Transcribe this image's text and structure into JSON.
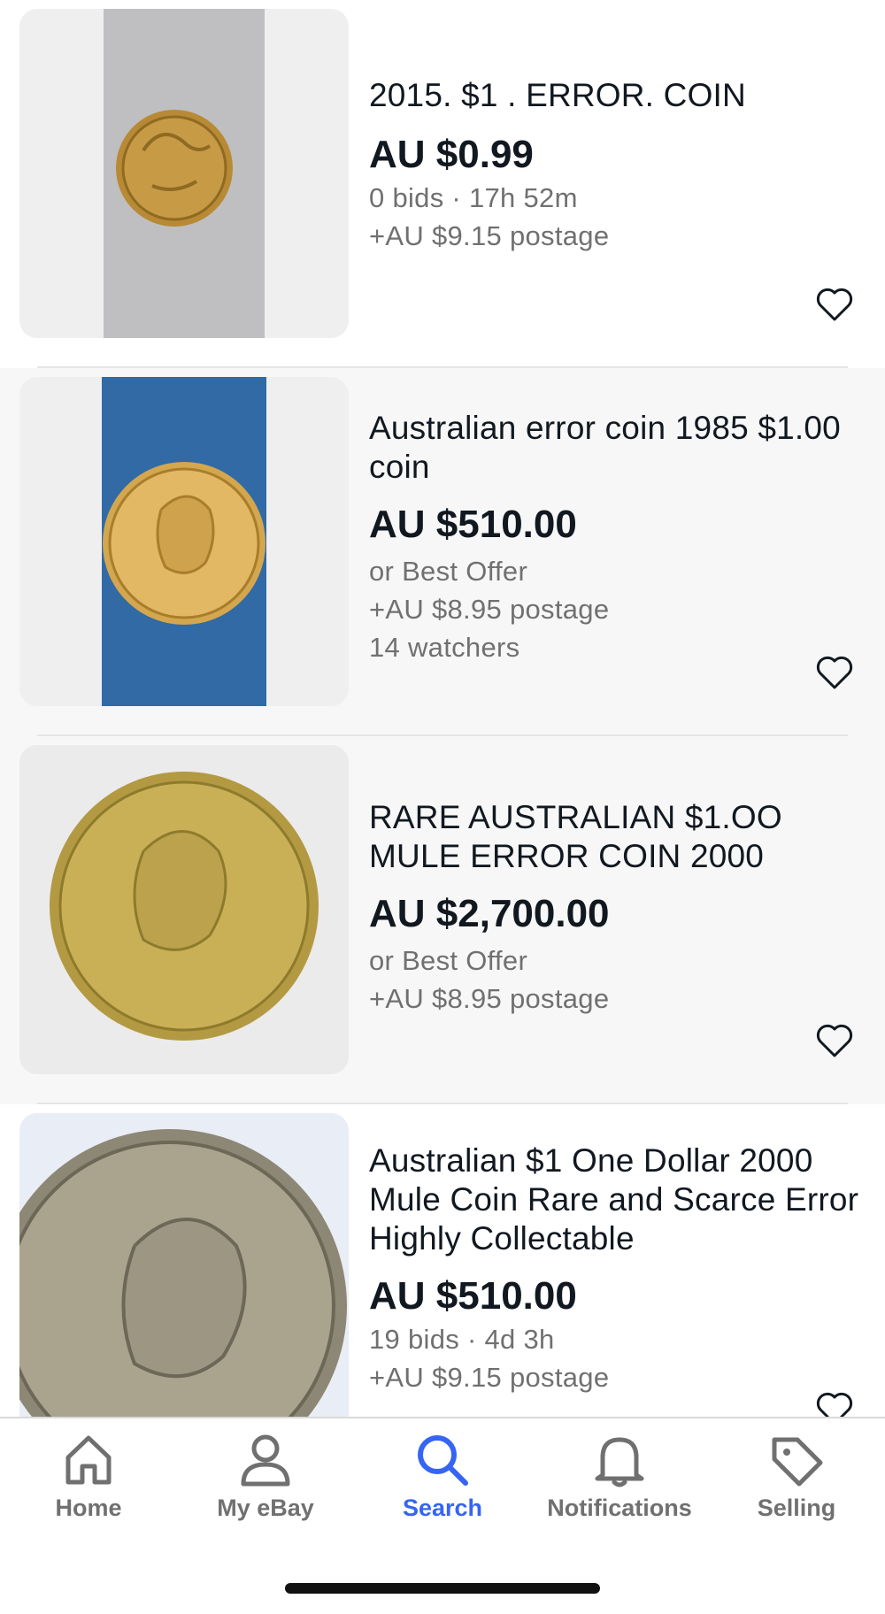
{
  "listings": [
    {
      "title": "2015. $1 . ERROR. COIN",
      "price": "AU $0.99",
      "meta": [
        "0 bids · 17h 52m",
        "+AU $9.15 postage"
      ]
    },
    {
      "title": "Australian error coin 1985 $1.00 coin",
      "price": "AU $510.00",
      "meta": [
        "or Best Offer",
        "+AU $8.95 postage",
        "14 watchers"
      ]
    },
    {
      "title": "RARE AUSTRALIAN $1.OO MULE  ERROR COIN 2000",
      "price": "AU $2,700.00",
      "meta": [
        "or Best Offer",
        "+AU $8.95 postage"
      ]
    },
    {
      "title": "Australian $1 One Dollar 2000 Mule Coin Rare and Scarce Error Highly Collectable",
      "price": "AU $510.00",
      "meta": [
        "19 bids · 4d 3h",
        "+AU $9.15 postage"
      ]
    }
  ],
  "tabs": [
    {
      "label": "Home",
      "icon": "home-icon"
    },
    {
      "label": "My eBay",
      "icon": "person-icon"
    },
    {
      "label": "Search",
      "icon": "search-icon",
      "active": true
    },
    {
      "label": "Notifications",
      "icon": "bell-icon"
    },
    {
      "label": "Selling",
      "icon": "tag-icon"
    }
  ],
  "colors": {
    "accent": "#3665f3",
    "muted_text": "#707070",
    "primary_text": "#111820"
  }
}
